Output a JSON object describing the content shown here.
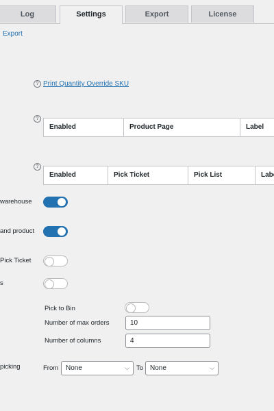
{
  "tabs": [
    {
      "label": "Log",
      "active": false
    },
    {
      "label": "Settings",
      "active": true
    },
    {
      "label": "Export",
      "active": false
    },
    {
      "label": "License",
      "active": false
    }
  ],
  "subnav": {
    "export_link": "Export"
  },
  "help_icon": "question-circle-icon",
  "print_override_link": "Print Quantity Override SKU",
  "table1": {
    "headers": [
      "Enabled",
      "Product Page",
      "Label"
    ]
  },
  "table2": {
    "headers": [
      "Enabled",
      "Pick Ticket",
      "Pick List",
      "Label"
    ]
  },
  "settings": [
    {
      "label": "warehouse",
      "state": "on"
    },
    {
      "label": "and product",
      "state": "on"
    },
    {
      "label": "Pick Ticket",
      "state": "off"
    },
    {
      "label": "s",
      "state": "off"
    }
  ],
  "pick_to_bin": {
    "label": "Pick to Bin",
    "state": "off"
  },
  "max_orders": {
    "label": "Number of max orders",
    "value": "10"
  },
  "columns": {
    "label": "Number of columns",
    "value": "4"
  },
  "picking": {
    "label": "picking",
    "from_label": "From",
    "from_value": "None",
    "to_label": "To",
    "to_value": "None"
  },
  "colors": {
    "accent": "#2271b1",
    "background": "#f0f0f1"
  }
}
